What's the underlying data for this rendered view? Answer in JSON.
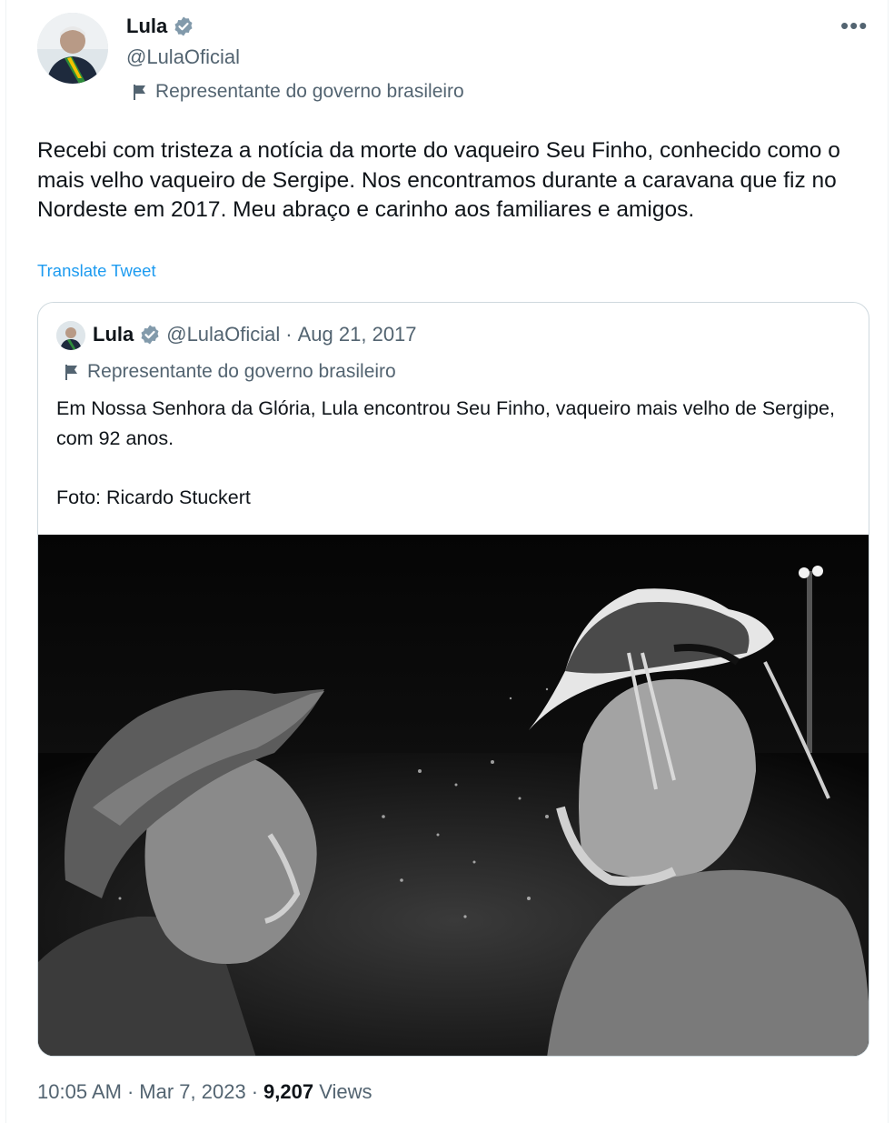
{
  "author": {
    "name": "Lula",
    "handle": "@LulaOficial",
    "affiliation": "Representante do governo brasileiro"
  },
  "menu_icon": "more-horizontal-icon",
  "tweet": {
    "text": "Recebi com tristeza a notícia da morte do vaqueiro Seu Finho, conhecido como o mais velho vaqueiro de Sergipe. Nos encontramos durante a caravana que fiz no Nordeste em 2017. Meu abraço e carinho aos familiares e amigos.",
    "translate_label": "Translate Tweet"
  },
  "quoted": {
    "name": "Lula",
    "handle": "@LulaOficial",
    "separator": "·",
    "date": "Aug 21, 2017",
    "affiliation": "Representante do governo brasileiro",
    "text_line_1": "Em Nossa Senhora da Glória, Lula encontrou Seu Finho, vaqueiro mais velho de Sergipe, com 92 anos.",
    "text_line_2": "",
    "text_line_3": "Foto: Ricardo Stuckert"
  },
  "footer": {
    "time": "10:05 AM",
    "sep1": "·",
    "date": "Mar 7, 2023",
    "sep2": "·",
    "views_count": "9,207",
    "views_label": "Views"
  },
  "colors": {
    "accent": "#1d9bf0",
    "secondary_text": "#536471",
    "primary_text": "#0f1419",
    "border": "#cfd9de"
  }
}
